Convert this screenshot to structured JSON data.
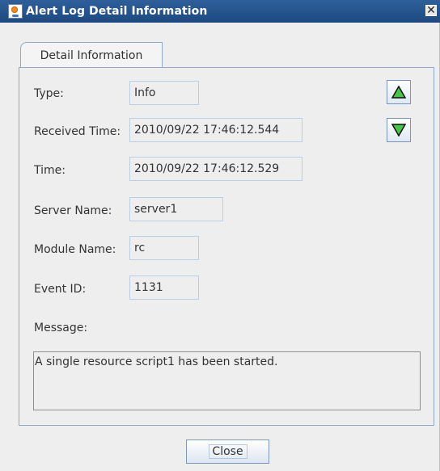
{
  "window": {
    "title": "Alert Log Detail Information",
    "title_icon": "java-icon",
    "close_icon": "close-icon",
    "close_symbol": "✕"
  },
  "tabs": [
    {
      "label": "Detail Information",
      "active": true
    }
  ],
  "fields": {
    "type": {
      "label": "Type:",
      "value": "Info"
    },
    "received_time": {
      "label": "Received Time:",
      "value": "2010/09/22 17:46:12.544"
    },
    "time": {
      "label": "Time:",
      "value": "2010/09/22 17:46:12.529"
    },
    "server_name": {
      "label": "Server Name:",
      "value": "server1"
    },
    "module_name": {
      "label": "Module Name:",
      "value": "rc"
    },
    "event_id": {
      "label": "Event ID:",
      "value": "1131"
    },
    "message": {
      "label": "Message:",
      "value": "A single resource script1 has been started."
    }
  },
  "navigation": {
    "previous_icon": "up-triangle-icon",
    "next_icon": "down-triangle-icon",
    "arrow_color": "#44c844"
  },
  "buttons": {
    "close_label": "Close"
  },
  "colors": {
    "titlebar": "#1f4f88",
    "panel_border": "#8fa9c7",
    "field_border": "#b8cfe6",
    "background": "#eeeeee"
  }
}
